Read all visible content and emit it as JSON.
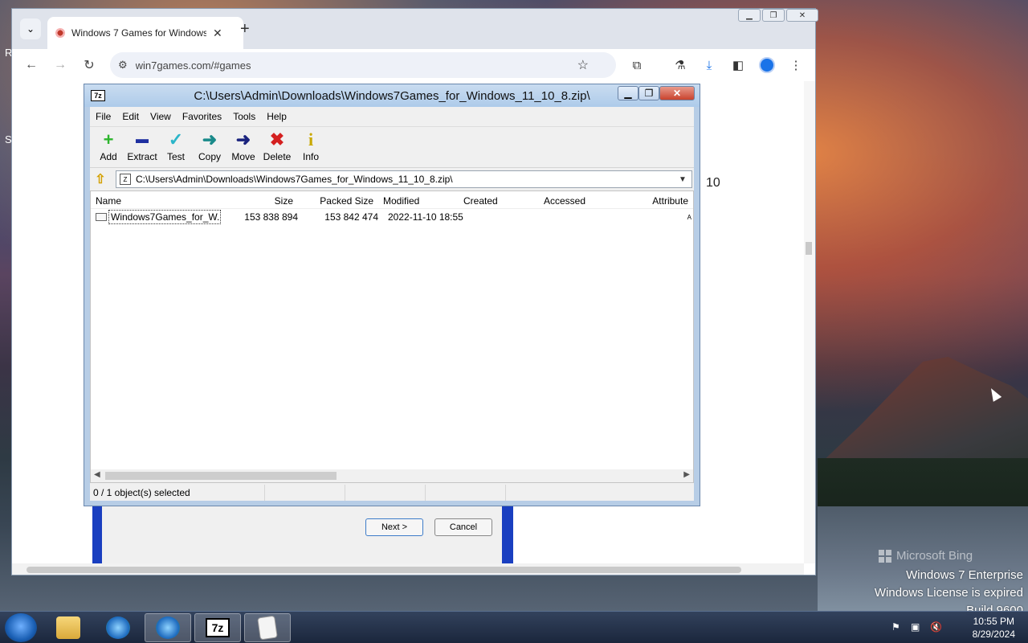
{
  "desktop": {
    "edge_letters": [
      "R",
      "S"
    ],
    "watermark": {
      "bing": "Microsoft Bing",
      "line1": "Windows 7 Enterprise",
      "line2": "Windows License is expired",
      "line3": "Build 9600"
    }
  },
  "browser": {
    "tab_title": "Windows 7 Games for Windows",
    "tab_close": "✕",
    "new_tab": "+",
    "url": "win7games.com/#games",
    "page_fragment": "10"
  },
  "installer": {
    "next_label": "Next >",
    "cancel_label": "Cancel"
  },
  "zip": {
    "icon_text": "7z",
    "title": "C:\\Users\\Admin\\Downloads\\Windows7Games_for_Windows_11_10_8.zip\\",
    "menu": [
      "File",
      "Edit",
      "View",
      "Favorites",
      "Tools",
      "Help"
    ],
    "tools": [
      {
        "label": "Add",
        "icon": "+",
        "color": "#2db52d"
      },
      {
        "label": "Extract",
        "icon": "▬",
        "color": "#1e2fa0"
      },
      {
        "label": "Test",
        "icon": "✓",
        "color": "#2bb5c9"
      },
      {
        "label": "Copy",
        "icon": "➜",
        "color": "#1a8a8a"
      },
      {
        "label": "Move",
        "icon": "➜",
        "color": "#1a237e"
      },
      {
        "label": "Delete",
        "icon": "✖",
        "color": "#d42020"
      },
      {
        "label": "Info",
        "icon": "i",
        "color": "#c9a800"
      }
    ],
    "path": "C:\\Users\\Admin\\Downloads\\Windows7Games_for_Windows_11_10_8.zip\\",
    "columns": [
      "Name",
      "Size",
      "Packed Size",
      "Modified",
      "Created",
      "Accessed",
      "Attribute"
    ],
    "rows": [
      {
        "name": "Windows7Games_for_W...",
        "size": "153 838 894",
        "packed": "153 842 474",
        "modified": "2022-11-10 18:55",
        "created": "",
        "accessed": "",
        "attr": "A"
      }
    ],
    "status": "0 / 1 object(s) selected"
  },
  "taskbar": {
    "seven_zip_text": "7z",
    "clock_time": "10:55 PM",
    "clock_date": "8/29/2024"
  }
}
